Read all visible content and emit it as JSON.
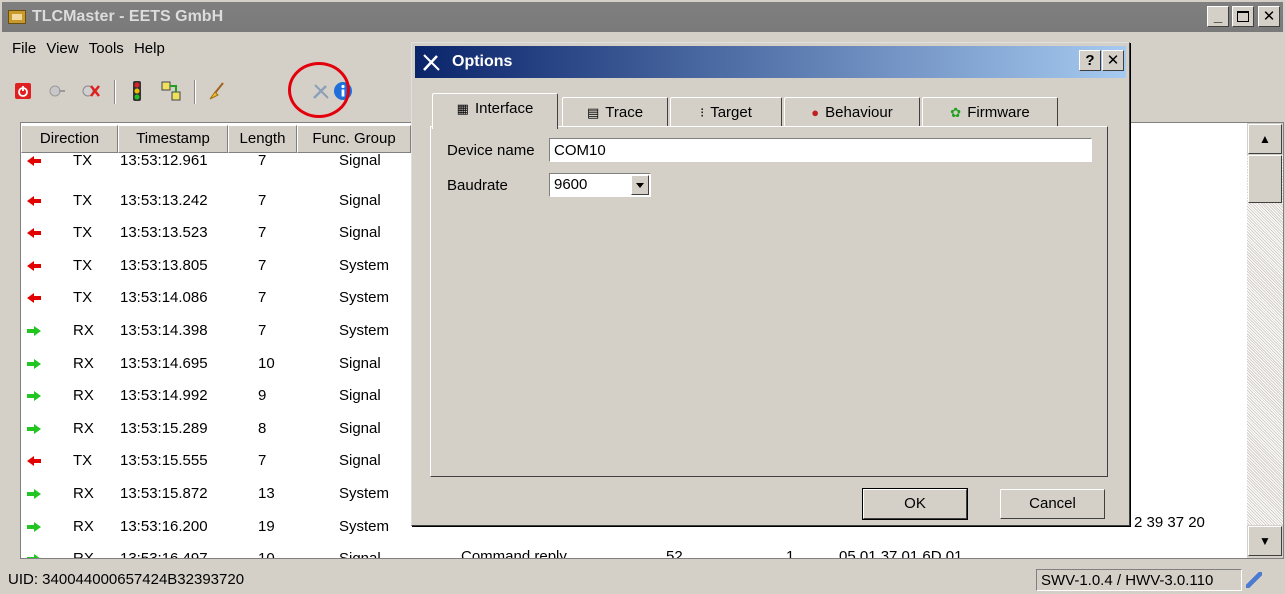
{
  "window": {
    "title": "TLCMaster - EETS GmbH"
  },
  "menu": [
    "File",
    "View",
    "Tools",
    "Help"
  ],
  "table": {
    "columns": [
      "Direction",
      "Timestamp",
      "Length",
      "Func. Group"
    ],
    "rows": [
      {
        "dir": "TX",
        "ts": "13:53:12.961",
        "len": "7",
        "group": "Signal"
      },
      {
        "dir": "TX",
        "ts": "13:53:13.242",
        "len": "7",
        "group": "Signal"
      },
      {
        "dir": "TX",
        "ts": "13:53:13.523",
        "len": "7",
        "group": "Signal"
      },
      {
        "dir": "TX",
        "ts": "13:53:13.805",
        "len": "7",
        "group": "System"
      },
      {
        "dir": "TX",
        "ts": "13:53:14.086",
        "len": "7",
        "group": "System"
      },
      {
        "dir": "RX",
        "ts": "13:53:14.398",
        "len": "7",
        "group": "System"
      },
      {
        "dir": "RX",
        "ts": "13:53:14.695",
        "len": "10",
        "group": "Signal"
      },
      {
        "dir": "RX",
        "ts": "13:53:14.992",
        "len": "9",
        "group": "Signal"
      },
      {
        "dir": "RX",
        "ts": "13:53:15.289",
        "len": "8",
        "group": "Signal"
      },
      {
        "dir": "TX",
        "ts": "13:53:15.555",
        "len": "7",
        "group": "Signal"
      },
      {
        "dir": "RX",
        "ts": "13:53:15.872",
        "len": "13",
        "group": "System"
      },
      {
        "dir": "RX",
        "ts": "13:53:16.200",
        "len": "19",
        "group": "System"
      },
      {
        "dir": "RX",
        "ts": "13:53:16.497",
        "len": "10",
        "group": "Signal"
      }
    ],
    "partial_last_row": {
      "desc": "Command reply",
      "c1": "52",
      "c2": "1",
      "data": "05 01 37 01 6D 01"
    },
    "hex_fragment": "2 39 37 20"
  },
  "status": {
    "uid": "UID: 340044000657424B32393720",
    "version": "SWV-1.0.4 / HWV-3.0.110"
  },
  "dialog": {
    "title": "Options",
    "help_label": "?",
    "tabs": [
      "Interface",
      "Trace",
      "Target",
      "Behaviour",
      "Firmware"
    ],
    "device_name_label": "Device name",
    "device_name_value": "COM10",
    "baudrate_label": "Baudrate",
    "baudrate_value": "9600",
    "ok_label": "OK",
    "cancel_label": "Cancel"
  },
  "colors": {
    "tx_arrow": "#e30000",
    "rx_arrow": "#22c522",
    "highlight_circle": "#e3000b"
  }
}
